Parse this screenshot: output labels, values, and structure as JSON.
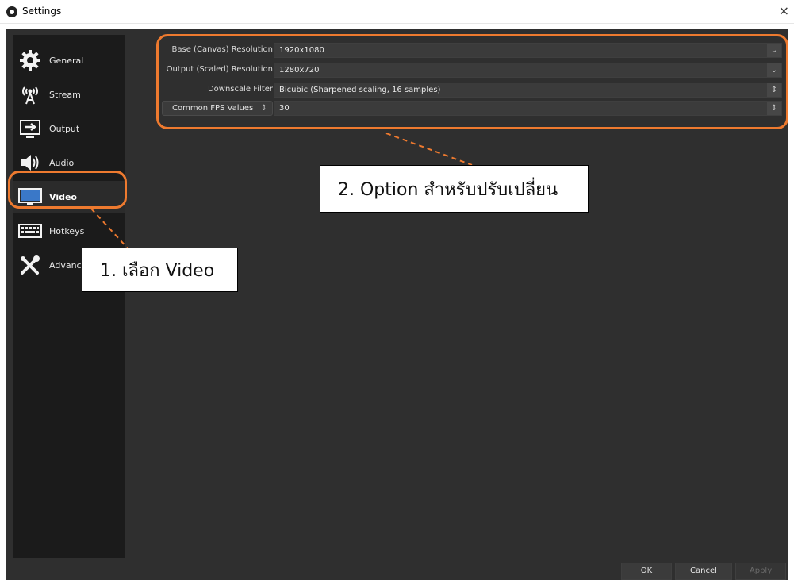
{
  "window": {
    "title": "Settings",
    "close_glyph": "×"
  },
  "sidebar": {
    "items": [
      {
        "label": "General",
        "icon": "gear-icon"
      },
      {
        "label": "Stream",
        "icon": "antenna-icon"
      },
      {
        "label": "Output",
        "icon": "output-monitor-icon"
      },
      {
        "label": "Audio",
        "icon": "speaker-icon"
      },
      {
        "label": "Video",
        "icon": "monitor-icon",
        "active": true
      },
      {
        "label": "Hotkeys",
        "icon": "keyboard-icon"
      },
      {
        "label": "Advanced",
        "icon": "tools-icon"
      }
    ]
  },
  "video_settings": {
    "base_resolution": {
      "label": "Base (Canvas) Resolution",
      "value": "1920x1080"
    },
    "output_resolution": {
      "label": "Output (Scaled) Resolution",
      "value": "1280x720"
    },
    "downscale_filter": {
      "label": "Downscale Filter",
      "value": "Bicubic (Sharpened scaling, 16 samples)"
    },
    "fps": {
      "label": "Common FPS Values",
      "value": "30"
    }
  },
  "buttons": {
    "ok": "OK",
    "cancel": "Cancel",
    "apply": "Apply"
  },
  "annotations": {
    "step1": "1. เลือก Video",
    "step2": "2. Option สำหรับปรับเปลี่ยน",
    "accent_color": "#ee7a2f"
  }
}
